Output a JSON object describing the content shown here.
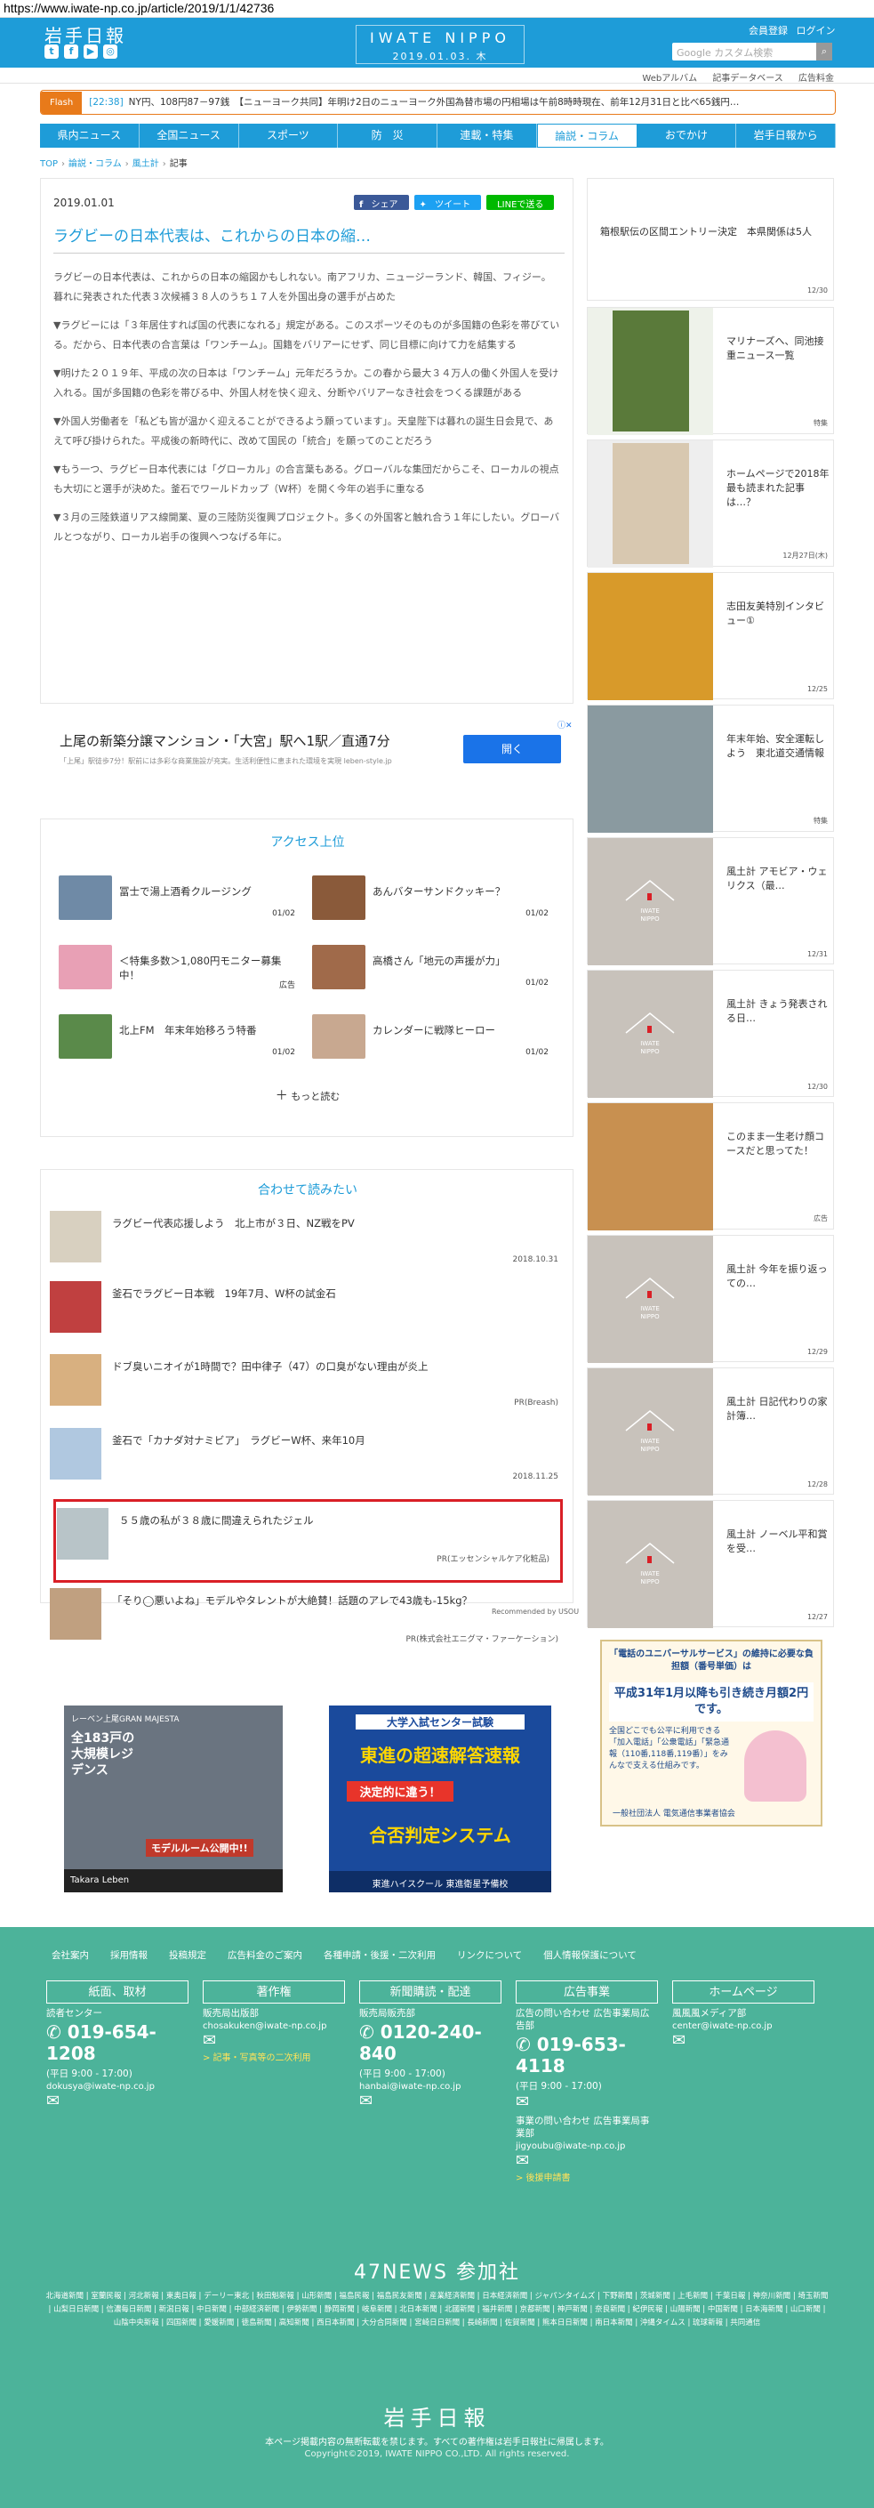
{
  "url": "https://www.iwate-np.co.jp/article/2019/1/1/42736",
  "header": {
    "logo": "岩手日報",
    "brand_name": "IWATE NIPPO",
    "brand_date": "2019.01.03. 木",
    "member_register": "会員登録",
    "login": "ログイン",
    "search_placeholder": "Google カスタム検索"
  },
  "subnav": [
    "Webアルバム",
    "記事データベース",
    "広告料金"
  ],
  "flash": {
    "tag": "Flash",
    "time": "[22:38]",
    "text": "NY円、108円87－97銭　【ニューヨーク共同】年明け2日のニューヨーク外国為替市場の円相場は午前8時時現在、前年12月31日と比べ65銭円…"
  },
  "nav": [
    "県内ニュース",
    "全国ニュース",
    "スポーツ",
    "防　災",
    "連載・特集",
    "論説・コラム",
    "おでかけ",
    "岩手日報から"
  ],
  "breadcrumb": [
    "TOP",
    "論説・コラム",
    "風土計",
    "記事"
  ],
  "article": {
    "date": "2019.01.01",
    "share_fb": "シェア",
    "share_tw": "ツイート",
    "share_line": "LINEで送る",
    "title": "ラグビーの日本代表は、これからの日本の縮…",
    "paragraphs": [
      "ラグビーの日本代表は、これからの日本の縮図かもしれない。南アフリカ、ニュージーランド、韓国、フィジー。暮れに発表された代表３次候補３８人のうち１７人を外国出身の選手が占めた",
      "▼ラグビーには「３年居住すれば国の代表になれる」規定がある。このスポーツそのものが多国籍の色彩を帯びている。だから、日本代表の合言葉は「ワンチーム」。国籍をバリアーにせず、同じ目標に向けて力を結集する",
      "▼明けた２０１９年、平成の次の日本は「ワンチーム」元年だろうか。この春から最大３４万人の働く外国人を受け入れる。国が多国籍の色彩を帯びる中、外国人材を快く迎え、分断やバリアーなき社会をつくる課題がある",
      "▼外国人労働者を「私ども皆が温かく迎えることができるよう願っています」。天皇陛下は暮れの誕生日会見で、あえて呼び掛けられた。平成後の新時代に、改めて国民の「統合」を願ってのことだろう",
      "▼もう一つ、ラグビー日本代表には「グローカル」の合言葉もある。グローバルな集団だからこそ、ローカルの視点も大切にと選手が決めた。釜石でワールドカップ（W杯）を開く今年の岩手に重なる",
      "▼３月の三陸鉄道リアス線開業、夏の三陸防災復興プロジェクト。多くの外国客と触れ合う１年にしたい。グローバルとつながり、ローカル岩手の復興へつなげる年に。"
    ]
  },
  "ad1": {
    "headline": "上尾の新築分譲マンション・「大宮」駅へ1駅／直通7分",
    "sub": "「上尾」駅徒歩7分！駅前には多彩な商業施設が充実。生活利便性に恵まれた環境を実現 leben-style.jp",
    "button": "開く"
  },
  "access": {
    "title": "アクセス上位",
    "items": [
      {
        "title": "冨士で湯上酒肴クルージング",
        "date": "01/02",
        "color": "#6f8aa6"
      },
      {
        "title": "あんバターサンドクッキー？",
        "date": "01/02",
        "color": "#8a5a3a"
      },
      {
        "title": "＜特集多数＞1,080円モニター募集中！",
        "date": "広告",
        "color": "#e8a0b5"
      },
      {
        "title": "高橋さん「地元の声援が力」",
        "date": "01/02",
        "color": "#a06a4a"
      },
      {
        "title": "北上FM　年末年始移ろう特番",
        "date": "01/02",
        "color": "#5a8a4a"
      },
      {
        "title": "カレンダーに戦隊ヒーロー",
        "date": "01/02",
        "color": "#c8a890"
      }
    ],
    "more": "もっと読む"
  },
  "also": {
    "title": "合わせて読みたい",
    "items": [
      {
        "title": "ラグビー代表応援しよう　北上市が３日、NZ戦をPV",
        "date": "2018.10.31",
        "color": "#d8d0c0"
      },
      {
        "title": "釜石でラグビー日本戦　19年7月、W杯の試金石",
        "date": "",
        "color": "#c04040"
      },
      {
        "title": "ドブ臭いニオイが1時間で？田中律子（47）の口臭がない理由が炎上",
        "date": "PR(Breash)",
        "color": "#d8b080"
      },
      {
        "title": "釜石で「カナダ対ナミビア」　ラグビーW杯、来年10月",
        "date": "2018.11.25",
        "color": "#b0c8e0"
      },
      {
        "title": "５５歳の私が３８歳に間違えられたジェル",
        "date": "PR(エッセンシャルケア化粧品)",
        "color": "#b8c4c8"
      },
      {
        "title": "「そり◯悪いよね」モデルやタレントが大絶賛！話題のアレで43歳も-15kg？",
        "date": "PR(株式会社エニグマ・ファーケーション)",
        "color": "#c0a080"
      }
    ],
    "recommended": "Recommended by USOU"
  },
  "bottom_ads": {
    "ad2_brand": "レーベン上尾GRAN MAJESTA",
    "ad2_text": "全183戸の大規模レジデンス",
    "ad2_cta": "モデルルーム公開中!!",
    "ad2_company": "Takara Leben",
    "ad3_head": "大学入試センター試験",
    "ad3_main": "東進の超速解答速報",
    "ad3_sub": "決定的に違う！",
    "ad3_sys": "合否判定システム",
    "ad3_foot": "東進ハイスクール 東進衛星予備校"
  },
  "sidebar": [
    {
      "title": "箱根駅伝の区間エントリー決定　本県関係は5人",
      "date": "12/30",
      "type": "text"
    },
    {
      "title": "マリナーズへ、同池接重ニュース一覧",
      "date": "特集",
      "type": "img",
      "color": "#5a7a3a"
    },
    {
      "title": "ホームページで2018年最も読まれた記事は…？",
      "date": "12月27日(木)",
      "type": "img",
      "color": "#d8c8b0"
    },
    {
      "title": "志田友美特別インタビュー①",
      "date": "12/25",
      "type": "img",
      "color": "#d89a2a"
    },
    {
      "title": "年末年始、安全運転しよう　東北道交通情報",
      "date": "特集",
      "type": "img",
      "color": "#8a9aa0"
    },
    {
      "title": "風土計 アモビア・ウェリクス（最…",
      "date": "12/31",
      "type": "ph"
    },
    {
      "title": "風土計 きょう発表される日…",
      "date": "12/30",
      "type": "ph"
    },
    {
      "title": "このまま一生老け顔コースだと思ってた！",
      "date": "広告",
      "type": "img",
      "color": "#c89050"
    },
    {
      "title": "風土計 今年を振り返っての…",
      "date": "12/29",
      "type": "ph"
    },
    {
      "title": "風土計 日記代わりの家計簿…",
      "date": "12/28",
      "type": "ph"
    },
    {
      "title": "風土計 ノーベル平和賞を受…",
      "date": "12/27",
      "type": "ph"
    }
  ],
  "side_ad": {
    "line1": "「電話のユニバーサルサービス」の維持に必要な負担額（番号単価）は",
    "line2": "平成31年1月以降も引き続き月額2円です。",
    "line3": "全国どこでも公平に利用できる「加入電話」「公衆電話」「緊急通報（110番,118番,119番）」をみんなで支える仕組みです。",
    "line4": "一般社団法人 電気通信事業者協会"
  },
  "footer": {
    "links": [
      "会社案内",
      "採用情報",
      "投稿規定",
      "広告料金のご案内",
      "各種申請・後援・二次利用",
      "リンクについて",
      "個人情報保護について"
    ],
    "cols": [
      {
        "head": "紙面、取材",
        "label": "読者センター",
        "tel": "019-654-1208",
        "hours": "(平日 9:00 - 17:00)",
        "mail": "dokusya@iwate-np.co.jp",
        "sub": ""
      },
      {
        "head": "著作権",
        "label": "販売局出版部",
        "tel": "",
        "hours": "",
        "mail": "chosakuken@iwate-np.co.jp",
        "sub": "> 記事・写真等の二次利用"
      },
      {
        "head": "新聞購読・配達",
        "label": "販売局販売部",
        "tel": "0120-240-840",
        "hours": "(平日 9:00 - 17:00)",
        "mail": "hanbai@iwate-np.co.jp",
        "sub": ""
      },
      {
        "head": "広告事業",
        "label": "広告の問い合わせ 広告事業局広告部",
        "tel": "019-653-4118",
        "hours": "(平日 9:00 - 17:00)",
        "mail": "jigyoubu@iwate-np.co.jp",
        "sub": "> 後援申請書",
        "label2": "事業の問い合わせ 広告事業局事業部"
      },
      {
        "head": "ホームページ",
        "label": "風風風メディア部",
        "tel": "",
        "hours": "",
        "mail": "center@iwate-np.co.jp",
        "sub": ""
      }
    ],
    "news47": "47NEWS 参加社",
    "papers": "北海道新聞 | 室蘭民報 | 河北新報 | 東奥日報 | デーリー東北 | 秋田魁新報 | 山形新聞 | 福島民報 | 福島民友新聞 | 産業経済新聞 | 日本経済新聞 | ジャパンタイムズ | 下野新聞 | 茨城新聞 | 上毛新聞 | 千葉日報 | 神奈川新聞 | 埼玉新聞 | 山梨日日新聞 | 信濃毎日新聞 | 新潟日報 | 中日新聞 | 中部経済新聞 | 伊勢新聞 | 静岡新聞 | 岐阜新聞 | 北日本新聞 | 北國新聞 | 福井新聞 | 京都新聞 | 神戸新聞 | 奈良新聞 | 紀伊民報 | 山陽新聞 | 中国新聞 | 日本海新聞 | 山口新聞 | 山陰中央新報 | 四国新聞 | 愛媛新聞 | 徳島新聞 | 高知新聞 | 西日本新聞 | 大分合同新聞 | 宮崎日日新聞 | 長崎新聞 | 佐賀新聞 | 熊本日日新聞 | 南日本新聞 | 沖縄タイムス | 琉球新報 | 共同通信",
    "logo": "岩手日報",
    "note": "本ページ掲載内容の無断転載を禁じます。すべての著作権は岩手日報社に帰属します。",
    "copyright": "Copyright©2019, IWATE NIPPO CO.,LTD. All rights reserved."
  },
  "colors": {
    "primary": "#1e9cd8",
    "footer": "#4cb39a",
    "flash": "#e87a1a",
    "highlight": "#d91f26"
  }
}
